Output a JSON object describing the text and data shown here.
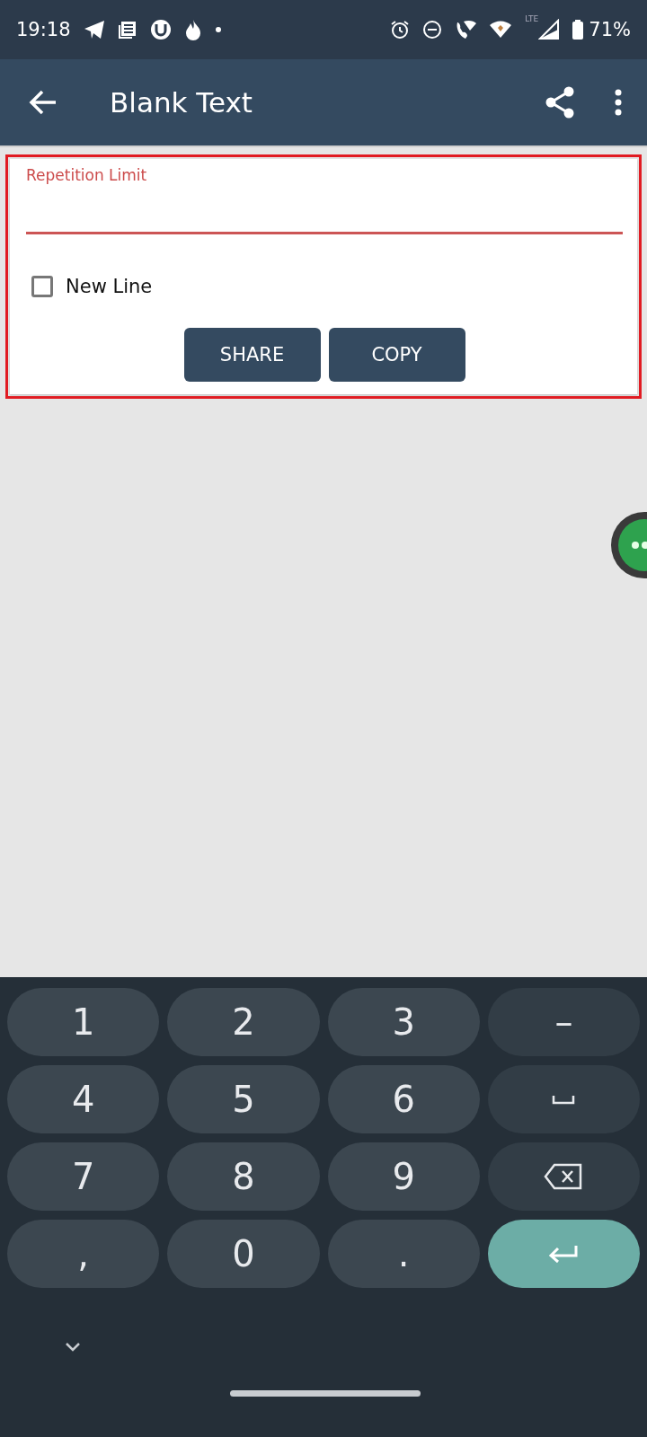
{
  "status_bar": {
    "time": "19:18",
    "network_label": "LTE",
    "battery": "71%"
  },
  "app_bar": {
    "title": "Blank Text"
  },
  "form": {
    "field": {
      "label": "Repetition Limit"
    },
    "checkbox": {
      "label": "New Line",
      "checked": false
    },
    "buttons": [
      "SHARE",
      "COPY"
    ]
  },
  "keyboard": {
    "keys": [
      {
        "kind": "char",
        "label": "1"
      },
      {
        "kind": "char",
        "label": "2"
      },
      {
        "kind": "char",
        "label": "3"
      },
      {
        "kind": "fn",
        "label": "–"
      },
      {
        "kind": "char",
        "label": "4"
      },
      {
        "kind": "char",
        "label": "5"
      },
      {
        "kind": "char",
        "label": "6"
      },
      {
        "kind": "space"
      },
      {
        "kind": "char",
        "label": "7"
      },
      {
        "kind": "char",
        "label": "8"
      },
      {
        "kind": "char",
        "label": "9"
      },
      {
        "kind": "backspace"
      },
      {
        "kind": "char",
        "label": ","
      },
      {
        "kind": "char",
        "label": "0"
      },
      {
        "kind": "char",
        "label": "."
      },
      {
        "kind": "enter"
      }
    ]
  }
}
